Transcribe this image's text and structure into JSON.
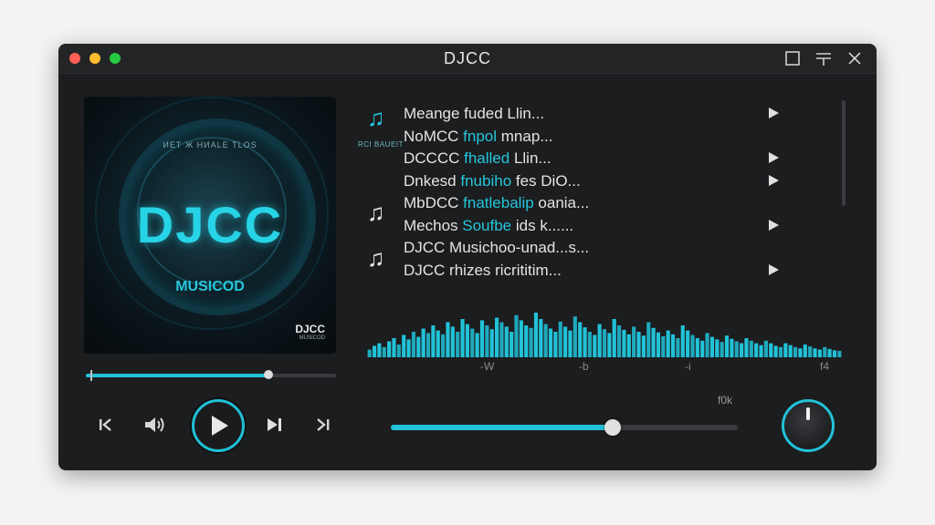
{
  "window": {
    "title": "DJCC"
  },
  "cover": {
    "subtitle": "ИЕТ Ж  HИАLЕ  ТLОS",
    "title": "DJCC",
    "label": "MUSICOD",
    "logo_main": "DJCC",
    "logo_sub": "MUSICOD"
  },
  "playback": {
    "progress": 0.73
  },
  "tracks": [
    {
      "parts": [
        "Meange fuded Llin...",
        ""
      ],
      "has_arrow": true
    },
    {
      "parts": [
        "NoMCC ",
        "fnpol",
        " mnap..."
      ],
      "has_arrow": false
    },
    {
      "parts": [
        "DCCCC ",
        "fhalled",
        " Llin..."
      ],
      "has_arrow": true
    },
    {
      "parts": [
        "Dnkesd  ",
        "fnubiho",
        " fes DiO..."
      ],
      "has_arrow": true
    },
    {
      "parts": [
        "MbDCC ",
        "fnatlebalip",
        " oania..."
      ],
      "has_arrow": false
    },
    {
      "parts": [
        "Mechos ",
        "Soufbe",
        " ids k......"
      ],
      "has_arrow": true
    },
    {
      "parts": [
        "DJCC Musichoo-unad...s...",
        ""
      ],
      "has_arrow": false
    },
    {
      "parts": [
        "DJCC rhizes ricrititim...",
        ""
      ],
      "has_arrow": true
    }
  ],
  "playlist_badge": "RCI  BAUEIT",
  "icons": {
    "music_note": "music-note-icon",
    "prev": "skip-previous-icon",
    "volume": "volume-icon",
    "play": "play-icon",
    "next": "skip-next-icon",
    "next_end": "skip-to-end-icon",
    "track_play": "track-play-icon",
    "maximize": "maximize-icon",
    "minimize": "minimize-icon",
    "close": "close-icon"
  },
  "waveform": {
    "axis_labels": [
      "-W",
      "-b",
      "-i",
      "f4"
    ],
    "levels": [
      0.12,
      0.18,
      0.22,
      0.16,
      0.25,
      0.3,
      0.2,
      0.35,
      0.28,
      0.4,
      0.32,
      0.45,
      0.38,
      0.5,
      0.42,
      0.36,
      0.55,
      0.48,
      0.4,
      0.6,
      0.52,
      0.45,
      0.38,
      0.58,
      0.5,
      0.44,
      0.62,
      0.55,
      0.48,
      0.4,
      0.66,
      0.58,
      0.5,
      0.46,
      0.7,
      0.6,
      0.52,
      0.45,
      0.4,
      0.56,
      0.48,
      0.42,
      0.64,
      0.55,
      0.47,
      0.4,
      0.35,
      0.52,
      0.44,
      0.38,
      0.6,
      0.5,
      0.43,
      0.36,
      0.48,
      0.4,
      0.34,
      0.55,
      0.46,
      0.39,
      0.33,
      0.42,
      0.36,
      0.3,
      0.5,
      0.42,
      0.35,
      0.3,
      0.26,
      0.38,
      0.32,
      0.28,
      0.24,
      0.34,
      0.29,
      0.25,
      0.22,
      0.3,
      0.26,
      0.22,
      0.19,
      0.26,
      0.22,
      0.18,
      0.16,
      0.22,
      0.19,
      0.16,
      0.14,
      0.2,
      0.17,
      0.14,
      0.12,
      0.16,
      0.13,
      0.11,
      0.1
    ]
  },
  "volume": {
    "level": 0.64,
    "readout": "f0k"
  },
  "colors": {
    "accent": "#22c2d8",
    "background": "#1c1d1f"
  }
}
